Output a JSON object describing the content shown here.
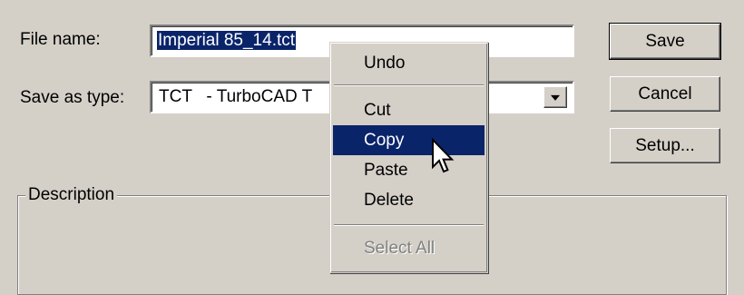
{
  "filename": {
    "label": "File name:",
    "value": "Imperial 85_14.tct"
  },
  "savetype": {
    "label": "Save as type:",
    "value": "TCT   - TurboCAD T"
  },
  "buttons": {
    "save": "Save",
    "cancel": "Cancel",
    "setup": "Setup..."
  },
  "description": {
    "legend": "Description"
  },
  "context_menu": {
    "undo": "Undo",
    "cut": "Cut",
    "copy": "Copy",
    "paste": "Paste",
    "delete": "Delete",
    "select_all": "Select All",
    "highlighted": "Copy"
  },
  "colors": {
    "face": "#d4d0c8",
    "highlight": "#0a246a"
  }
}
